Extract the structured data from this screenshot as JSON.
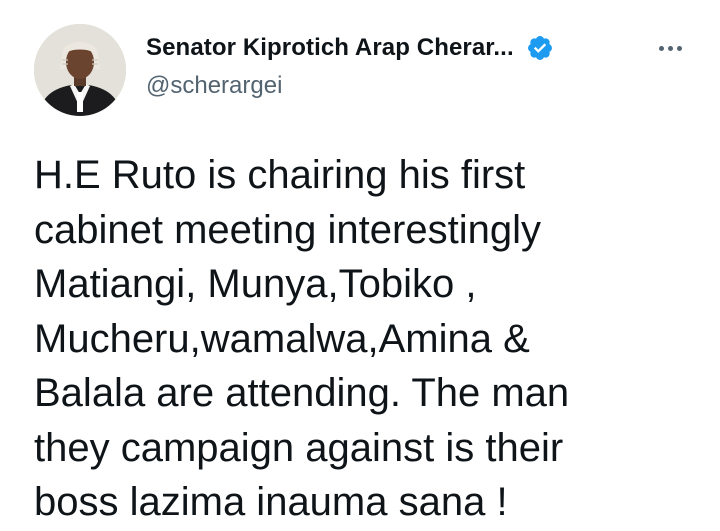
{
  "author": {
    "display_name": "Senator Kiprotich Arap Cherar...",
    "handle": "@scherargei",
    "verified": true,
    "avatar_icon": "profile-photo",
    "verified_icon": "verified-badge-icon",
    "verified_color": "#1d9bf0"
  },
  "menu": {
    "more_icon": "more-horizontal-icon"
  },
  "tweet": {
    "lines": [
      "H.E Ruto is chairing his first",
      "cabinet meeting interestingly",
      "Matiangi, Munya,Tobiko ,",
      "Mucheru,wamalwa,Amina &",
      "Balala are attending. The man",
      "they campaign against is their",
      "boss lazima inauma sana !"
    ]
  }
}
